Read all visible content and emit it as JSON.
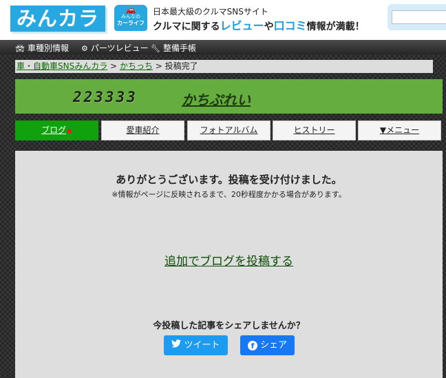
{
  "header": {
    "logo": "みんカラ",
    "carlife_badge": {
      "line1": "みんなの",
      "line2": "カーライフ"
    },
    "tagline_top": "日本最大級のクルマSNSサイト",
    "tagline_main": {
      "part1": "クルマに関する",
      "review": "レビュー",
      "part2": "や",
      "kuchikomi": "口コミ",
      "part3": "情報が満載！"
    },
    "search": {
      "value": "",
      "placeholder": ""
    }
  },
  "topnav": {
    "items": [
      {
        "label": "車種別情報",
        "icon": "car-icon"
      },
      {
        "label": "パーツレビュー",
        "icon": "parts-icon"
      },
      {
        "label": "整備手帳",
        "icon": "wrench-icon"
      }
    ]
  },
  "breadcrumb": {
    "home": "車・自動車SNSみんカラ",
    "sep": ">",
    "user": "かちっち",
    "current": "投稿完了"
  },
  "blog": {
    "counter": "223333",
    "name": "かちぷれい"
  },
  "tabs": [
    {
      "label": "ブログ",
      "badge": "●",
      "active": true
    },
    {
      "label": "愛車紹介",
      "active": false
    },
    {
      "label": "フォトアルバム",
      "active": false
    },
    {
      "label": "ヒストリー",
      "active": false
    },
    {
      "label": "▼メニュー",
      "active": false
    }
  ],
  "main": {
    "thanks": "ありがとうございます。投稿を受け付けました。",
    "note": "※情報がページに反映されるまで、20秒程度かかる場合があります。",
    "add_post": "追加でブログを投稿する",
    "share_prompt": "今投稿した記事をシェアしませんか？",
    "tweet_label": "ツイート",
    "facebook_label": "シェア"
  },
  "colors": {
    "brand_blue": "#27a8e0",
    "blog_green": "#66ad3f",
    "active_tab": "#11a00e",
    "twitter": "#1d9bf0",
    "facebook": "#1877f2"
  }
}
